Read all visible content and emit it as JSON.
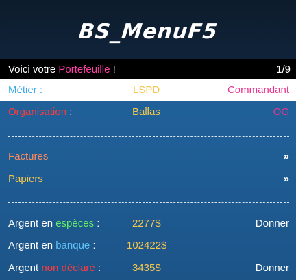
{
  "banner": {
    "title": "BS_MenuF5"
  },
  "subtitle": {
    "prefix": "Voici votre ",
    "highlight": "Portefeuille",
    "suffix": " !",
    "counter": "1/9"
  },
  "rows": {
    "metier": {
      "label": "Métier",
      "colon": " :",
      "value": "LSPD",
      "grade": "Commandant"
    },
    "organisation": {
      "label": "Organisation",
      "colon": " :",
      "value": "Ballas",
      "grade": "OG"
    },
    "factures": {
      "label": "Factures",
      "arrow": "»"
    },
    "papiers": {
      "label": "Papiers",
      "arrow": "»"
    },
    "especes": {
      "prefix": "Argent en ",
      "highlight": "espèces",
      "colon": " :",
      "amount": "2277$",
      "action": "Donner"
    },
    "banque": {
      "prefix": "Argent en ",
      "highlight": "banque",
      "colon": " :",
      "amount": "102422$"
    },
    "sale": {
      "prefix": "Argent ",
      "highlight": "non déclaré",
      "colon": " :",
      "amount": "3435$",
      "action": "Donner"
    }
  },
  "colors": {
    "banner_bg": "#0d1c2c",
    "menu_bg": "#1f5e96",
    "selected_bg": "#ffffff",
    "highlight_pink": "#ff3fa6",
    "value_gold": "#f5c64c",
    "label_red": "#ff3b3b",
    "label_orange": "#ff8a5c",
    "label_green": "#66ee66",
    "label_blue": "#5fc1f5"
  },
  "icons": {
    "submenu": "double-chevron-right-icon"
  }
}
